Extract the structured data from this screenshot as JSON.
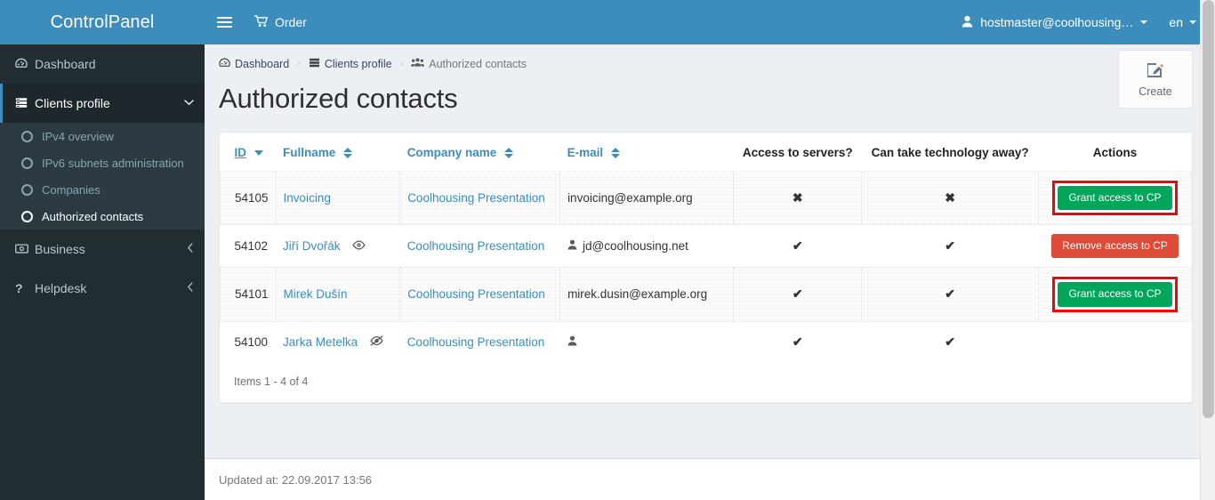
{
  "brand": {
    "title": "ControlPanel"
  },
  "topbar": {
    "hamburger_icon": "hamburger-icon",
    "order_label": "Order",
    "order_icon": "cart-icon",
    "user_label": "hostmaster@coolhousing…",
    "user_icon": "user-icon",
    "lang_label": "en"
  },
  "sidebar": {
    "items": [
      {
        "label": "Dashboard",
        "icon": "dashboard-icon",
        "active": false
      },
      {
        "label": "Clients profile",
        "icon": "server-list-icon",
        "active": true,
        "arrow": "chevron-down-icon"
      },
      {
        "label": "Business",
        "icon": "money-icon",
        "active": false,
        "arrow": "chevron-left-icon"
      },
      {
        "label": "Helpdesk",
        "icon": "question-icon",
        "active": false,
        "arrow": "chevron-left-icon"
      }
    ],
    "submenu": [
      {
        "label": "IPv4 overview",
        "current": false
      },
      {
        "label": "IPv6 subnets administration",
        "current": false
      },
      {
        "label": "Companies",
        "current": false
      },
      {
        "label": "Authorized contacts",
        "current": true
      }
    ]
  },
  "breadcrumb": [
    {
      "label": "Dashboard",
      "icon": "dashboard-icon"
    },
    {
      "label": "Clients profile",
      "icon": "server-list-icon"
    },
    {
      "label": "Authorized contacts",
      "icon": "users-icon"
    }
  ],
  "page": {
    "title": "Authorized contacts",
    "create_label": "Create",
    "create_icon": "edit-square-icon"
  },
  "table": {
    "columns": [
      {
        "label": "ID",
        "sort": "desc",
        "align": "left",
        "style": "link"
      },
      {
        "label": "Fullname",
        "sort": "both",
        "align": "left",
        "style": "link"
      },
      {
        "label": "Company name",
        "sort": "both",
        "align": "left",
        "style": "link"
      },
      {
        "label": "E-mail",
        "sort": "both",
        "align": "left",
        "style": "link"
      },
      {
        "label": "Access to servers?",
        "sort": "none",
        "align": "center",
        "style": "dark"
      },
      {
        "label": "Can take technology away?",
        "sort": "none",
        "align": "center",
        "style": "dark"
      },
      {
        "label": "Actions",
        "sort": "none",
        "align": "center",
        "style": "dark"
      }
    ],
    "rows": [
      {
        "id": "54105",
        "fullname": "Invoicing",
        "name_icon": "",
        "company": "Coolhousing Presentation",
        "email": "invoicing@example.org",
        "email_icon": "",
        "access_servers": "✖",
        "take_away": "✖",
        "action_label": "Grant access to CP",
        "action_type": "grant",
        "highlighted": true
      },
      {
        "id": "54102",
        "fullname": "Jiří Dvořák",
        "name_icon": "eye-icon",
        "company": "Coolhousing Presentation",
        "email": "jd@coolhousing.net",
        "email_icon": "user-icon",
        "access_servers": "✔",
        "take_away": "✔",
        "action_label": "Remove access to CP",
        "action_type": "remove",
        "highlighted": false
      },
      {
        "id": "54101",
        "fullname": "Mirek Dušín",
        "name_icon": "",
        "company": "Coolhousing Presentation",
        "email": "mirek.dusin@example.org",
        "email_icon": "",
        "access_servers": "✔",
        "take_away": "✔",
        "action_label": "Grant access to CP",
        "action_type": "grant",
        "highlighted": true
      },
      {
        "id": "54100",
        "fullname": "Jarka Metelka",
        "name_icon": "eye-slash-icon",
        "company": "Coolhousing Presentation",
        "email": "",
        "email_icon": "user-icon",
        "access_servers": "✔",
        "take_away": "✔",
        "action_label": "",
        "action_type": "none",
        "highlighted": false
      }
    ],
    "footer_text": "Items 1 - 4 of 4"
  },
  "footer": {
    "updated_text": "Updated at: 22.09.2017 13:56"
  },
  "colors": {
    "brand_blue": "#3c8dbc",
    "sidebar_dark": "#222d32",
    "submenu_bg": "#2c3b41",
    "link_blue": "#3c8dbc",
    "grant_green": "#00a65a",
    "remove_red": "#dd4b39",
    "highlight_red": "#ff0000",
    "page_bg": "#ecf0f5"
  }
}
